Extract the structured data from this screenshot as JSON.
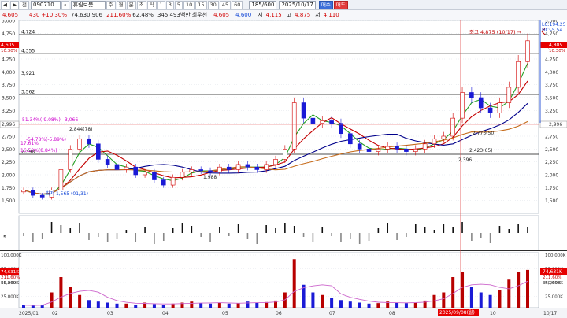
{
  "toolbar": {
    "nav_prev": "◀",
    "nav_next": "▶",
    "market_select": "전",
    "stock_code": "090710",
    "search_icon": "search-icon",
    "stock_name": "휴림로봇",
    "period_buttons": [
      "주",
      "월",
      "분",
      "초",
      "틱"
    ],
    "interval_buttons": [
      "1",
      "3",
      "5",
      "10",
      "15",
      "30",
      "45",
      "60"
    ],
    "range_value": "185/600",
    "date_value": "2025/10/17",
    "sell_label": "매수",
    "buy_label": "매도"
  },
  "quote": {
    "price": "4,605",
    "change": "430",
    "change_rate": "+10.30%",
    "volume": "74,630,906",
    "vol_ratio": "211.60%",
    "turnover": "62.48%",
    "amount": "345,493백만",
    "sector": "최우선",
    "best_ask": "4,605",
    "best_bid": "4,600",
    "open_label": "시",
    "open": "4,115",
    "high_label": "고",
    "high": "4,875",
    "low_label": "저",
    "low": "4,110"
  },
  "price_axis_ticks": [
    "5,000",
    "4,750",
    "4,500",
    "4,250",
    "4,000",
    "3,750",
    "3,500",
    "3,250",
    "3,000",
    "2,750",
    "2,500",
    "2,250",
    "2,000",
    "1,750",
    "1,500"
  ],
  "right_labels": {
    "lc": "LC:194.25",
    "hc": "HC:-5.54",
    "price_box": "4,805",
    "price_box_pct": "10.30%",
    "ref_box": "2,996"
  },
  "left_labels": {
    "price_box": "4,605",
    "price_box_pct": "10.30%",
    "ref_box": "2,996"
  },
  "hlines": [
    "4,724",
    "4,355",
    "3,921",
    "3,562",
    "2,398"
  ],
  "annotations": {
    "high": "최고 4,875 (10/17) →",
    "a1": "51.34%(-9.08%)",
    "a2": "3,066",
    "a3": "2,844(78)",
    "a4": "-54.78%(-5.89%)",
    "a5": "17.61%",
    "a6": "16.50%(8.84%)",
    "a7": "최저 1,565 (01/31)",
    "a8": "1,988",
    "a9": "2,423(65)",
    "a10": "2,396",
    "a11": "2,773(50)",
    "a12": "2,398"
  },
  "sub1_label": "5",
  "vol_axis_ticks": [
    "100,000K",
    "75,000K",
    "50,000K",
    "25,000K"
  ],
  "vol_right_box": "74,631K",
  "vol_right_pct": "211.60%",
  "vol_right_ref": "35,269K",
  "vol_left_box": "74,631K",
  "vol_left_pct": "211.60%",
  "vol_left_ref": "35,269K",
  "date_axis": [
    "2025/01",
    "02",
    "03",
    "04",
    "05",
    "06",
    "07",
    "08",
    "10",
    "10/17"
  ],
  "crosshair_date": "2025/09/08(월)",
  "colors": {
    "up": "#d20000",
    "down": "#1a1ad6",
    "ma5": "#e066ff",
    "ma20": "#c40000",
    "ma60": "#00008b",
    "ma120": "#c66b1a",
    "cloud": "#22a022"
  },
  "chart_data": {
    "type": "candlestick",
    "ylim": [
      1250,
      5000
    ],
    "close_approx": [
      1700,
      1600,
      1565,
      1700,
      2100,
      2500,
      2700,
      2600,
      2300,
      2200,
      2100,
      2150,
      2000,
      2050,
      1900,
      1800,
      1950,
      2050,
      2100,
      2080,
      2050,
      2150,
      2100,
      2200,
      2150,
      2100,
      2200,
      2300,
      2500,
      3400,
      3100,
      3000,
      3050,
      3000,
      2800,
      2600,
      2500,
      2450,
      2500,
      2550,
      2500,
      2450,
      2500,
      2600,
      2700,
      2750,
      3100,
      3600,
      3500,
      3300,
      3200,
      3400,
      3700,
      4200,
      4605
    ],
    "volume_approx": [
      5,
      4,
      6,
      30,
      60,
      40,
      25,
      15,
      12,
      10,
      8,
      8,
      6,
      10,
      7,
      6,
      8,
      10,
      12,
      9,
      8,
      10,
      8,
      9,
      12,
      10,
      11,
      14,
      30,
      95,
      45,
      30,
      25,
      20,
      15,
      12,
      10,
      8,
      9,
      12,
      10,
      9,
      10,
      14,
      25,
      30,
      60,
      70,
      40,
      30,
      25,
      35,
      55,
      70,
      74
    ]
  }
}
